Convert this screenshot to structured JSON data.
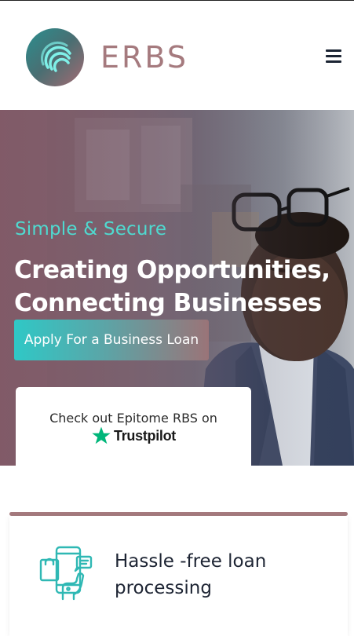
{
  "header": {
    "logo_text": "ERBS",
    "menu_icon": "hamburger-menu-icon"
  },
  "hero": {
    "eyebrow": "Simple & Secure",
    "title_line1": "Creating Opportunities,",
    "title_line2": "Connecting Businesses",
    "cta_label": "Apply For a Business Loan"
  },
  "trustpilot": {
    "text": "Check out Epitome RBS on",
    "brand": "Trustpilot",
    "star_icon": "trustpilot-star-icon"
  },
  "feature": {
    "title": "Hassle -free loan processing",
    "icon": "mobile-shopping-icon"
  },
  "colors": {
    "brand": "#a57a7e",
    "accent": "#4fdad0",
    "dark_text": "#1d2433",
    "trustpilot_green": "#00b67a"
  }
}
